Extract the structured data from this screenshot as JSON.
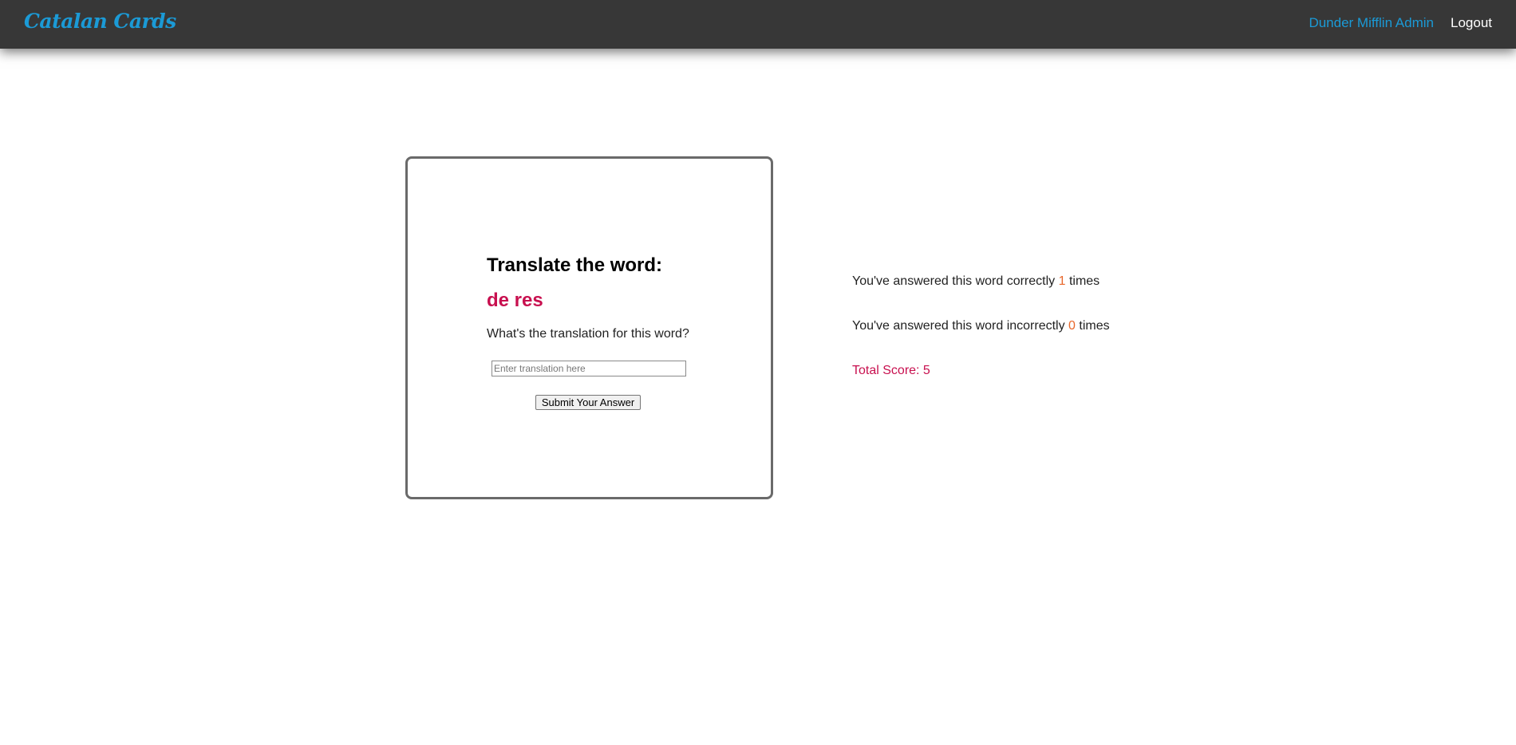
{
  "header": {
    "brand": "Catalan Cards",
    "user": "Dunder Mifflin Admin",
    "logout": "Logout"
  },
  "card": {
    "prompt": "Translate the word:",
    "word": "de res",
    "question": "What's the translation for this word?",
    "input_placeholder": "Enter translation here",
    "input_value": "",
    "submit_label": "Submit Your Answer"
  },
  "stats": {
    "correct_prefix": "You've answered this word correctly ",
    "correct_count": "1",
    "correct_suffix": " times",
    "incorrect_prefix": "You've answered this word incorrectly ",
    "incorrect_count": "0",
    "incorrect_suffix": " times",
    "total_score": "Total Score: 5"
  },
  "colors": {
    "brand_accent": "#1b9ad6",
    "word_color": "#c8104f",
    "count_color": "#e8682c",
    "header_bg": "#373737"
  }
}
